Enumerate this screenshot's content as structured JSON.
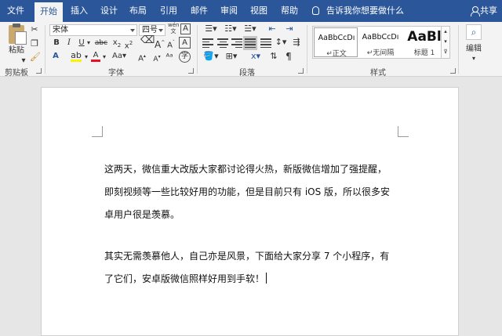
{
  "tabs": [
    {
      "label": "文件"
    },
    {
      "label": "开始"
    },
    {
      "label": "插入"
    },
    {
      "label": "设计"
    },
    {
      "label": "布局"
    },
    {
      "label": "引用"
    },
    {
      "label": "邮件"
    },
    {
      "label": "审阅"
    },
    {
      "label": "视图"
    },
    {
      "label": "帮助"
    }
  ],
  "tell_me": "告诉我你想要做什么",
  "share": "共享",
  "ribbon": {
    "clipboard": {
      "paste": "粘贴",
      "label": "剪贴板"
    },
    "font": {
      "name": "宋体",
      "size": "四号",
      "wen": "wén",
      "label": "字体",
      "aa": "Aa"
    },
    "paragraph": {
      "label": "段落"
    },
    "styles": {
      "label": "样式",
      "items": [
        {
          "sample": "AaBbCcDı",
          "name": "正文"
        },
        {
          "sample": "AaBbCcDı",
          "name": "无间隔"
        },
        {
          "sample": "AaBl",
          "name": "标题 1"
        }
      ]
    },
    "editing": {
      "label": "编辑"
    }
  },
  "document": {
    "paragraphs": [
      [
        "这两天，微信重大改版大家都讨论得火热，新版微信增加了强提醒，",
        "即刻视频等一些比较好用的功能，但是目前只有 iOS 版，所以很多安",
        "卓用户很是羡慕。"
      ],
      [
        "其实无需羡慕他人，自己亦是风景，下面给大家分享 7 个小程序，有",
        "了它们，安卓版微信照样好用到手软！"
      ]
    ]
  },
  "colors": {
    "accent": "#2b579a",
    "ribbon_bg": "#f3f3f3",
    "canvas_bg": "#e6e6e6"
  }
}
